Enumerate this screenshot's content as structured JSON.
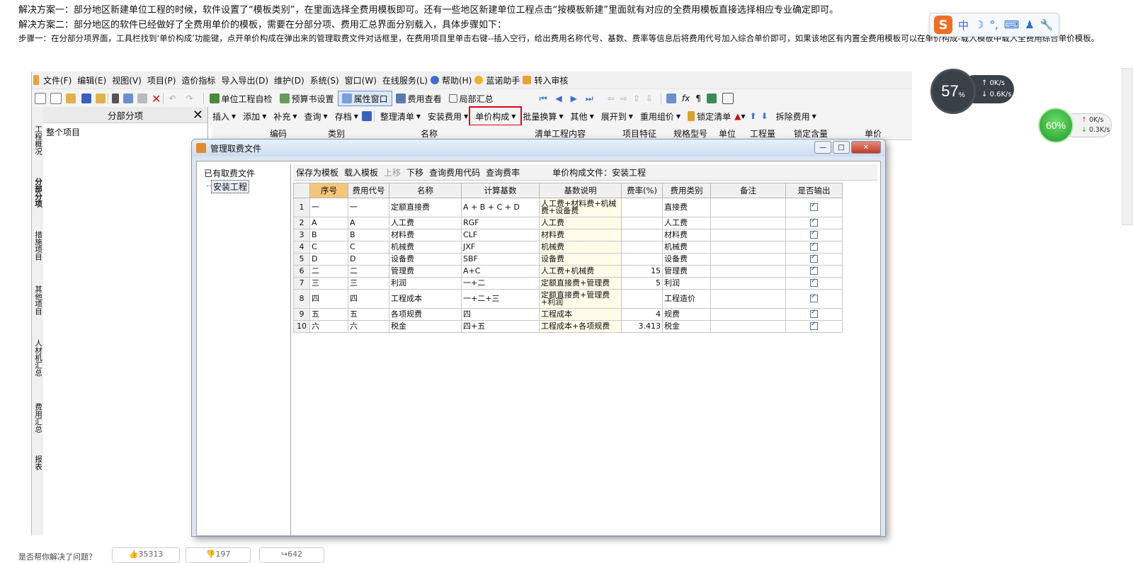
{
  "intro": {
    "line1": "解决方案一：部分地区新建单位工程的时候，软件设置了“模板类别”，在里面选择全费用模板即可。还有一些地区新建单位工程点击“按模板新建”里面就有对应的全费用模板直接选择相应专业确定即可。",
    "line2": "解决方案二：部分地区的软件已经做好了全费用单价的模板，需要在分部分项、费用汇总界面分别载入，具体步骤如下：",
    "line3": "步骤一：在分部分项界面，工具栏找到‘单价构成’功能键，点开单价构成在弹出来的管理取费文件对话框里，在费用项目里单击右键--插入空行，给出费用名称代号、基数、费率等信息后将费用代号加入综合单价即可，如果该地区有内置全费用模板可以在单价构成-载入模板中载入全费用综合单价模板。"
  },
  "ime": {
    "logo": "S",
    "items": [
      "中",
      "☽",
      "°,",
      "⌨",
      "♟",
      "🔧"
    ]
  },
  "monitor1": {
    "percent": "57",
    "unit": "%",
    "up": "0K/s",
    "down": "0.6K/s"
  },
  "monitor2": {
    "percent": "60%",
    "up": "0K/s",
    "down": "0.3K/s"
  },
  "menu": [
    "文件(F)",
    "编辑(E)",
    "视图(V)",
    "项目(P)",
    "造价指标",
    "导入导出(D)",
    "维护(D)",
    "系统(S)",
    "窗口(W)",
    "在线服务(L)",
    "帮助(H)",
    "蓝诺助手",
    "转入审核"
  ],
  "toolbar1": [
    "单位工程自检",
    "预算书设置",
    "属性窗口",
    "费用查看",
    "局部汇总"
  ],
  "toolbar2": [
    "插入",
    "添加",
    "补充",
    "查询",
    "存档",
    "整理清单",
    "安装费用",
    "单价构成",
    "批量换算",
    "其他",
    "展开到",
    "重用组价",
    "锁定清单",
    "拆除费用"
  ],
  "left_panel": {
    "title": "分部分项",
    "root": "整个项目"
  },
  "vtabs": [
    "工程概况",
    "分部分项",
    "措施项目",
    "其他项目",
    "人材机汇总",
    "费用汇总",
    "报表"
  ],
  "bg_headers": [
    "编码",
    "类别",
    "名称",
    "清单工程内容",
    "项目特征",
    "规格型号",
    "单位",
    "工程量",
    "锁定含量",
    "单价"
  ],
  "dialog": {
    "title": "管理取费文件",
    "tree_label": "已有取费文件",
    "tree_node": "安装工程",
    "toolbar": [
      "保存为模板",
      "载入模板",
      "上移",
      "下移",
      "查询费用代码",
      "查询费率"
    ],
    "file_label": "单价构成文件：安装工程",
    "columns": [
      "序号",
      "费用代号",
      "名称",
      "计算基数",
      "基数说明",
      "费率(%)",
      "费用类别",
      "备注",
      "是否输出"
    ],
    "rows": [
      {
        "n": "1",
        "seq": "一",
        "code": "一",
        "name": "定额直接费",
        "base": "A + B + C + D",
        "desc": "人工费+材料费+机械费+设备费",
        "rate": "",
        "type": "直接费",
        "note": "",
        "tall": true
      },
      {
        "n": "2",
        "seq": "A",
        "code": "A",
        "name": "人工费",
        "base": "RGF",
        "desc": "人工费",
        "rate": "",
        "type": "人工费",
        "note": "",
        "tall": false
      },
      {
        "n": "3",
        "seq": "B",
        "code": "B",
        "name": "材料费",
        "base": "CLF",
        "desc": "材料费",
        "rate": "",
        "type": "材料费",
        "note": "",
        "tall": false
      },
      {
        "n": "4",
        "seq": "C",
        "code": "C",
        "name": "机械费",
        "base": "JXF",
        "desc": "机械费",
        "rate": "",
        "type": "机械费",
        "note": "",
        "tall": false
      },
      {
        "n": "5",
        "seq": "D",
        "code": "D",
        "name": "设备费",
        "base": "SBF",
        "desc": "设备费",
        "rate": "",
        "type": "设备费",
        "note": "",
        "tall": false
      },
      {
        "n": "6",
        "seq": "二",
        "code": "二",
        "name": "管理费",
        "base": "A+C",
        "desc": "人工费+机械费",
        "rate": "15",
        "type": "管理费",
        "note": "",
        "tall": false
      },
      {
        "n": "7",
        "seq": "三",
        "code": "三",
        "name": "利润",
        "base": "一+二",
        "desc": "定额直接费+管理费",
        "rate": "5",
        "type": "利润",
        "note": "",
        "tall": false
      },
      {
        "n": "8",
        "seq": "四",
        "code": "四",
        "name": "工程成本",
        "base": "一+二+三",
        "desc": "定额直接费+管理费+利润",
        "rate": "",
        "type": "工程造价",
        "note": "",
        "tall": true
      },
      {
        "n": "9",
        "seq": "五",
        "code": "五",
        "name": "各项规费",
        "base": "四",
        "desc": "工程成本",
        "rate": "4",
        "type": "规费",
        "note": "",
        "tall": false
      },
      {
        "n": "10",
        "seq": "六",
        "code": "六",
        "name": "税金",
        "base": "四+五",
        "desc": "工程成本+各项规费",
        "rate": "3.413",
        "type": "税金",
        "note": "",
        "tall": false
      }
    ]
  },
  "feedback": {
    "question": "是否帮你解决了问题？",
    "likes": "35313",
    "dislikes": "197",
    "shares": "642"
  }
}
